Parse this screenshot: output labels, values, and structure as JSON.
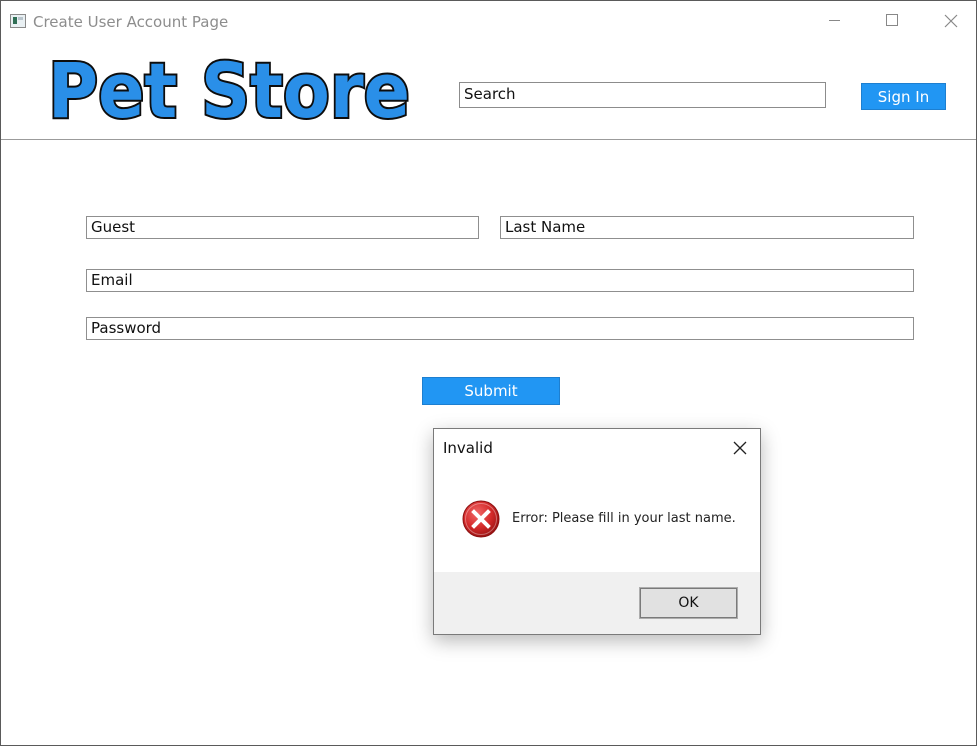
{
  "window": {
    "title": "Create User Account Page",
    "app_icon": "app-window-icon",
    "minimize_icon": "minimize-icon",
    "maximize_icon": "maximize-icon",
    "close_icon": "close-icon"
  },
  "header": {
    "logo_text": "Pet Store",
    "search_value": "Search",
    "signin_label": "Sign In"
  },
  "form": {
    "first_name_value": "Guest",
    "last_name_value": "Last Name",
    "email_value": "Email",
    "password_value": "Password",
    "submit_label": "Submit"
  },
  "dialog": {
    "title": "Invalid",
    "message": "Error: Please fill in your last name.",
    "ok_label": "OK",
    "icon": "error-icon"
  },
  "colors": {
    "accent": "#2196f3",
    "logo_fill": "#2a8fe8",
    "error_red": "#d42a2a"
  }
}
